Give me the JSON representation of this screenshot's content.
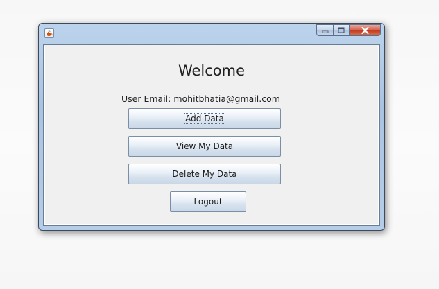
{
  "window": {
    "title": "",
    "icon": "java-cup-icon",
    "controls": {
      "minimize": "minimize-icon",
      "maximize": "maximize-icon",
      "close": "close-icon"
    }
  },
  "content": {
    "heading": "Welcome",
    "email_label": "User Email:",
    "email_value": "mohitbhatia@gmail.com",
    "buttons": {
      "add": "Add Data",
      "view": "View My Data",
      "delete": "Delete My Data",
      "logout": "Logout"
    }
  },
  "colors": {
    "close_button": "#c1351d",
    "window_frame": "#a9c4e2",
    "client_background": "#f0f0f0"
  }
}
